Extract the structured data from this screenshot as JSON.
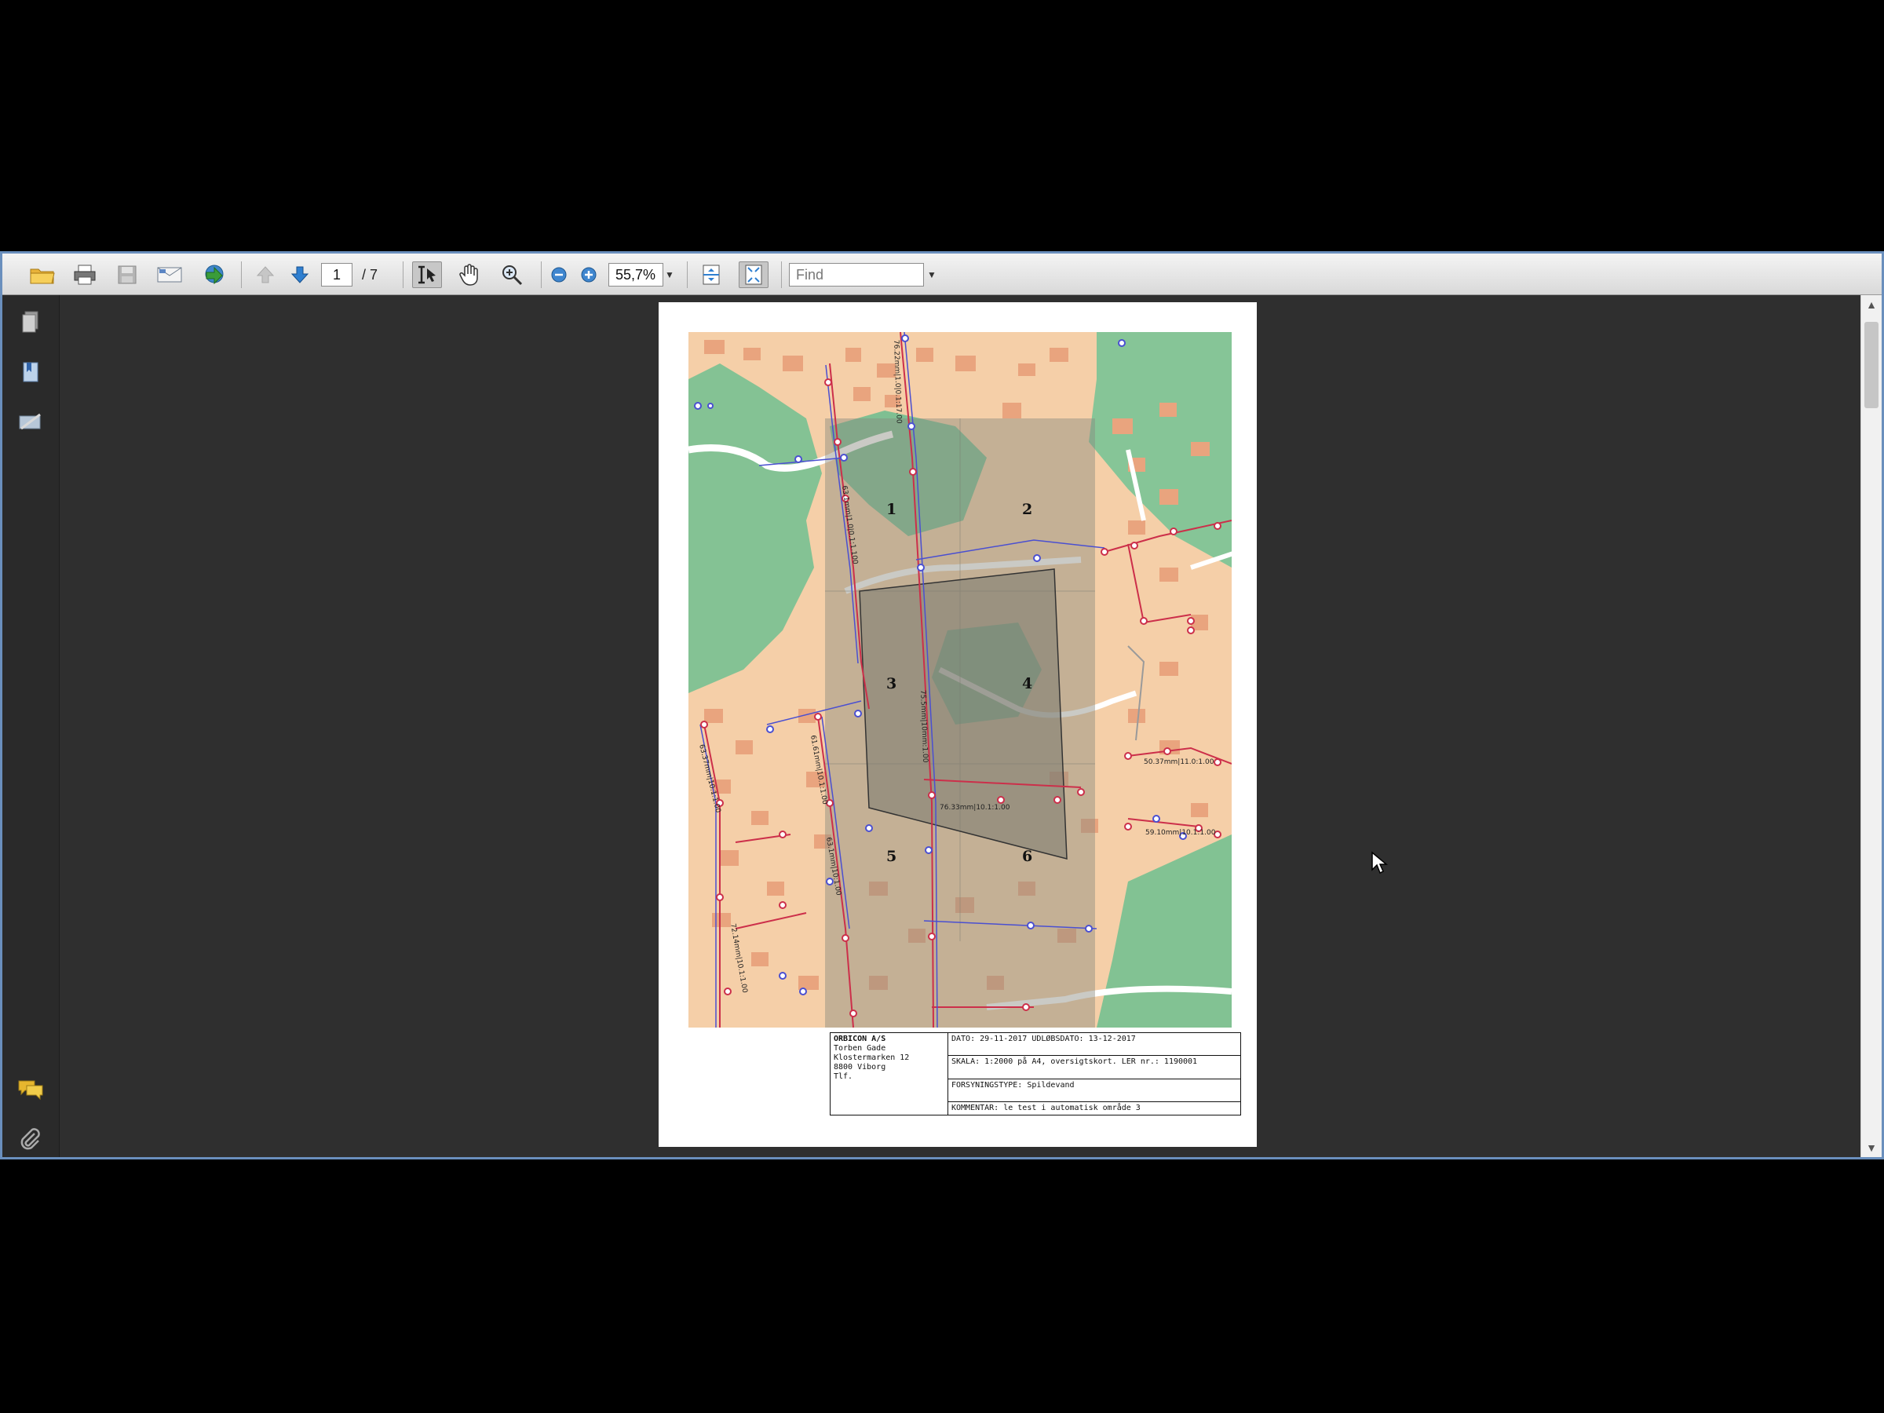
{
  "toolbar": {
    "page_current": "1",
    "page_total": "/ 7",
    "zoom": "55,7%",
    "find_placeholder": "Find",
    "icons": [
      "open-icon",
      "print-icon",
      "save-icon",
      "email-icon",
      "collaborate-icon",
      "prev-page-icon",
      "next-page-icon",
      "select-tool-icon",
      "hand-tool-icon",
      "zoom-tool-icon",
      "zoom-out-icon",
      "zoom-in-icon",
      "scroll-mode-icon",
      "fit-page-icon"
    ]
  },
  "sidebar": {
    "icons": [
      "pages-icon",
      "bookmarks-icon",
      "signatures-icon",
      "comments-icon",
      "attachments-icon"
    ]
  },
  "document": {
    "map": {
      "cells": [
        "1",
        "2",
        "3",
        "4",
        "5",
        "6"
      ],
      "colors": {
        "built": "#f5cba4",
        "house": "#e8a079",
        "green": "#82c193",
        "road": "#ffffff",
        "line_red": "#cc2f4a",
        "line_blue": "#4a4fd1",
        "overlay": "#8a8a7e"
      },
      "pipe_labels": [
        "76.22mm|1.0|0.1:17.00",
        "63.1mm|1.0|0.1:1.100",
        "75.5mm|10mm:1.00",
        "61.61mm|10.1:1.00",
        "76.33mm|10.1:1.00",
        "50.37mm|11.0:1.00",
        "63.37mm|10.1:1.00",
        "59.10mm|10.1:1.00",
        "63.1mm|10:1.00",
        "72.14mm|10.1:1.00"
      ]
    },
    "info": {
      "company": "ORBICON A/S",
      "contact": "Torben Gade",
      "address": "Klostermarken 12",
      "city": "8800 Viborg",
      "phone": "Tlf.",
      "date": "DATO: 29-11-2017   UDLØBSDATO: 13-12-2017",
      "scale": "SKALA: 1:2000 på A4, oversigtskort. LER nr.: 1190001",
      "supply": "FORSYNINGSTYPE: Spildevand",
      "comment": "KOMMENTAR: le test i automatisk område 3"
    }
  }
}
